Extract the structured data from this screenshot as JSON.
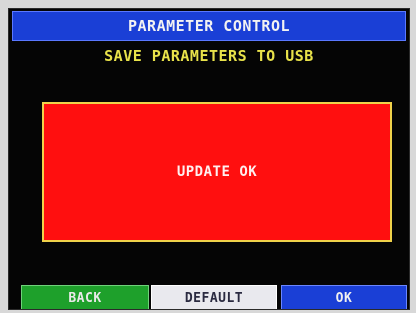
{
  "header": {
    "title": "PARAMETER CONTROL"
  },
  "subtitle": "SAVE PARAMETERS TO USB",
  "status": {
    "message": "UPDATE OK",
    "color": "#ff0f0f"
  },
  "buttons": {
    "back_label": "BACK",
    "default_label": "DEFAULT",
    "ok_label": "OK"
  },
  "colors": {
    "title_bar": "#1a3fd6",
    "subtitle_text": "#e8e24a",
    "back_button": "#1ea02b",
    "default_button": "#e9e9ee",
    "ok_button": "#1a3fd6"
  }
}
